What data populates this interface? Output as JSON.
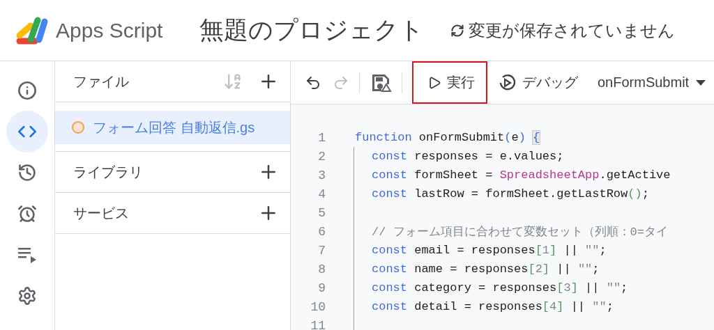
{
  "header": {
    "app_name": "Apps Script",
    "project_title": "無題のプロジェクト",
    "save_status": "変更が保存されていません"
  },
  "rail": [
    {
      "kind": "overview",
      "selected": false
    },
    {
      "kind": "editor",
      "selected": true
    },
    {
      "kind": "history",
      "selected": false
    },
    {
      "kind": "triggers",
      "selected": false
    },
    {
      "kind": "executions",
      "selected": false
    },
    {
      "kind": "settings",
      "selected": false
    }
  ],
  "files_panel": {
    "title": "ファイル",
    "files": [
      {
        "name": "フォーム回答 自動返信.gs",
        "selected": true,
        "unsaved": true
      }
    ],
    "sections": [
      {
        "title": "ライブラリ"
      },
      {
        "title": "サービス"
      }
    ]
  },
  "toolbar": {
    "undo": {
      "disabled": false
    },
    "redo": {
      "disabled": true
    },
    "run": {
      "label": "実行",
      "highlighted": true
    },
    "debug": {
      "label": "デバッグ"
    },
    "function_select": {
      "value": "onFormSubmit"
    }
  },
  "code": [
    {
      "number": "1",
      "indented": false,
      "tokens": [
        {
          "kind": "keyword",
          "text": "function"
        },
        {
          "kind": "plain",
          "text": " onFormSubmit"
        },
        {
          "kind": "paren",
          "text": "("
        },
        {
          "kind": "plain",
          "text": "e"
        },
        {
          "kind": "paren",
          "text": ") "
        },
        {
          "kind": "match",
          "text": "{"
        }
      ]
    },
    {
      "number": "2",
      "indented": true,
      "tokens": [
        {
          "kind": "keyword",
          "text": "const"
        },
        {
          "kind": "plain",
          "text": " responses = e.values;"
        }
      ]
    },
    {
      "number": "3",
      "indented": true,
      "tokens": [
        {
          "kind": "keyword",
          "text": "const"
        },
        {
          "kind": "plain",
          "text": " formSheet = "
        },
        {
          "kind": "class",
          "text": "SpreadsheetApp"
        },
        {
          "kind": "plain",
          "text": ".getActive"
        }
      ]
    },
    {
      "number": "4",
      "indented": true,
      "tokens": [
        {
          "kind": "keyword",
          "text": "const"
        },
        {
          "kind": "plain",
          "text": " lastRow = formSheet.getLastRow"
        },
        {
          "kind": "bracket",
          "text": "()"
        },
        {
          "kind": "plain",
          "text": ";"
        }
      ]
    },
    {
      "number": "5",
      "indented": true
    },
    {
      "number": "6",
      "indented": true,
      "tokens": [
        {
          "kind": "comment",
          "text": "// フォーム項目に合わせて変数セット（列順：0=タイ"
        }
      ]
    },
    {
      "number": "7",
      "indented": true,
      "tokens": [
        {
          "kind": "keyword",
          "text": "const"
        },
        {
          "kind": "plain",
          "text": " email = responses"
        },
        {
          "kind": "bracket",
          "text": "["
        },
        {
          "kind": "number",
          "text": "1"
        },
        {
          "kind": "bracket",
          "text": "]"
        },
        {
          "kind": "plain",
          "text": " || "
        },
        {
          "kind": "string",
          "text": "\"\""
        },
        {
          "kind": "plain",
          "text": ";"
        }
      ]
    },
    {
      "number": "8",
      "indented": true,
      "tokens": [
        {
          "kind": "keyword",
          "text": "const"
        },
        {
          "kind": "plain",
          "text": " name = responses"
        },
        {
          "kind": "bracket",
          "text": "["
        },
        {
          "kind": "number",
          "text": "2"
        },
        {
          "kind": "bracket",
          "text": "]"
        },
        {
          "kind": "plain",
          "text": " || "
        },
        {
          "kind": "string",
          "text": "\"\""
        },
        {
          "kind": "plain",
          "text": ";"
        }
      ]
    },
    {
      "number": "9",
      "indented": true,
      "tokens": [
        {
          "kind": "keyword",
          "text": "const"
        },
        {
          "kind": "plain",
          "text": " category = responses"
        },
        {
          "kind": "bracket",
          "text": "["
        },
        {
          "kind": "number",
          "text": "3"
        },
        {
          "kind": "bracket",
          "text": "]"
        },
        {
          "kind": "plain",
          "text": " || "
        },
        {
          "kind": "string",
          "text": "\"\""
        },
        {
          "kind": "plain",
          "text": ";"
        }
      ]
    },
    {
      "number": "10",
      "indented": true,
      "tokens": [
        {
          "kind": "keyword",
          "text": "const"
        },
        {
          "kind": "plain",
          "text": " detail = responses"
        },
        {
          "kind": "bracket",
          "text": "["
        },
        {
          "kind": "number",
          "text": "4"
        },
        {
          "kind": "bracket",
          "text": "]"
        },
        {
          "kind": "plain",
          "text": " || "
        },
        {
          "kind": "string",
          "text": "\"\""
        },
        {
          "kind": "plain",
          "text": ";"
        }
      ]
    },
    {
      "number": "11",
      "indented": true
    }
  ]
}
